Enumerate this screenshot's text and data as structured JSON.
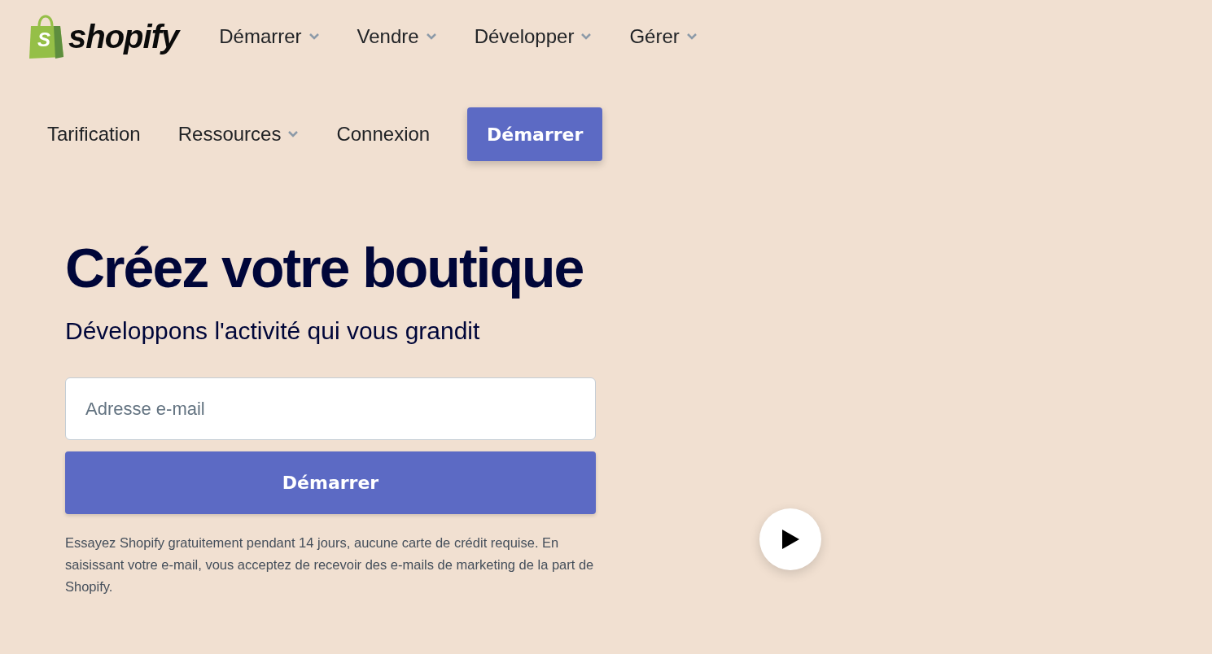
{
  "logo": {
    "mark": "S",
    "wordmark": "shopify"
  },
  "main_nav": [
    {
      "label": "Démarrer",
      "has_menu": true
    },
    {
      "label": "Vendre",
      "has_menu": true
    },
    {
      "label": "Développer",
      "has_menu": true
    },
    {
      "label": "Gérer",
      "has_menu": true
    }
  ],
  "secondary_nav": [
    {
      "label": "Tarification",
      "has_menu": false
    },
    {
      "label": "Ressources",
      "has_menu": true
    },
    {
      "label": "Connexion",
      "has_menu": false
    }
  ],
  "header_button": "Démarrer",
  "hero": {
    "title": "Créez votre boutique",
    "subtitle": "Développons l'activité qui vous grandit",
    "email_placeholder": "Adresse e-mail",
    "submit": "Démarrer",
    "fine_print": "Essayez Shopify gratuitement pendant 14 jours, aucune carte de crédit requise. En saisissant votre e-mail, vous acceptez de recevoir des e-mails de marketing de la part de Shopify."
  }
}
